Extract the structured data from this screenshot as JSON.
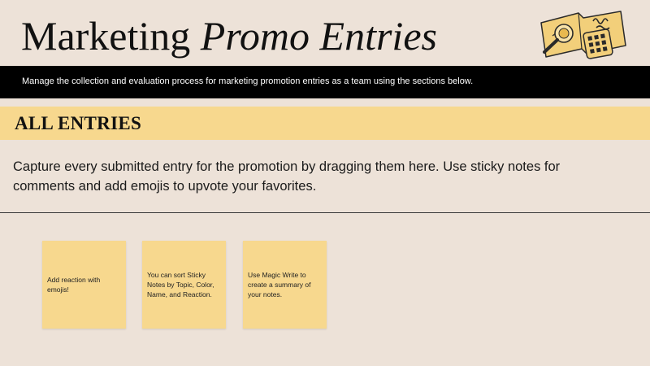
{
  "header": {
    "title_plain": "Marketing",
    "title_italic": "Promo Entries",
    "illustration_icon": "notebook-magnifier-calculator-icon"
  },
  "banner": {
    "text": "Manage the collection and evaluation process for marketing promotion entries as a team using the sections below."
  },
  "section": {
    "title": "ALL ENTRIES",
    "description": "Capture every submitted entry for the promotion by dragging them here. Use sticky notes for comments and add emojis to upvote your favorites."
  },
  "notes": [
    {
      "text": "Add reaction with emojis!"
    },
    {
      "text": "You can sort Sticky Notes by Topic, Color, Name, and Reaction."
    },
    {
      "text": "Use Magic Write to create a summary of your notes."
    }
  ],
  "colors": {
    "background": "#ede2d8",
    "banner": "#000000",
    "accent_yellow": "#f7d88e"
  }
}
